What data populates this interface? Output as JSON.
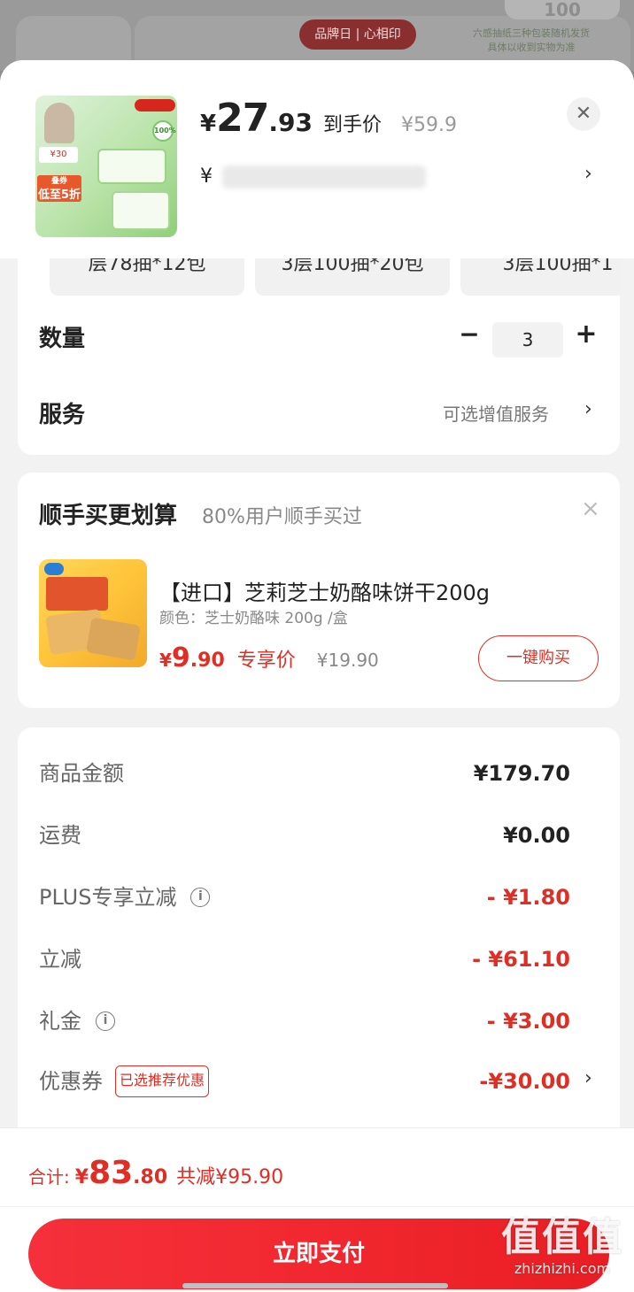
{
  "background": {
    "badge_text": "品牌日 | 心相印",
    "note_line1": "六感抽纸三种包装随机发货",
    "note_line2": "具体以收到实物为准",
    "corner_text": "100"
  },
  "product": {
    "currency": "¥",
    "price_integer": "27",
    "price_decimal": ".93",
    "price_label": "到手价",
    "original_price": "¥59.9",
    "spec_prefix": "¥",
    "image_tag_100": "100%",
    "image_price": "¥30",
    "image_promo_line1": "叠券",
    "image_promo_line2": "低至5折"
  },
  "specs": {
    "chips": [
      {
        "line": "层78抽*12包"
      },
      {
        "line": "3层100抽*20包"
      },
      {
        "line": "3层100抽*1"
      }
    ]
  },
  "quantity": {
    "label": "数量",
    "minus": "−",
    "value": "3",
    "plus": "+"
  },
  "service": {
    "label": "服务",
    "value": "可选增值服务",
    "chevron": "›"
  },
  "upsell": {
    "title": "顺手买更划算",
    "subtitle": "80%用户顺手买过",
    "close": "×",
    "item_name": "【进口】芝莉芝士奶酪味饼干200g",
    "item_attr": "颜色：芝士奶酪味 200g /盒",
    "price_currency": "¥",
    "price_integer": "9",
    "price_decimal": ".90",
    "price_label": "专享价",
    "original_price": "¥19.90",
    "buy_button": "一键购买"
  },
  "summary": {
    "rows": [
      {
        "label": "商品金额",
        "value": "¥179.70"
      },
      {
        "label": "运费",
        "value": "¥0.00"
      },
      {
        "label": "PLUS专享立减",
        "value": "- ¥1.80"
      },
      {
        "label": "立减",
        "value": "- ¥61.10"
      },
      {
        "label": "礼金",
        "value": "- ¥3.00"
      },
      {
        "label": "优惠券",
        "value": "-¥30.00"
      }
    ],
    "coupon_tag": "已选推荐优惠",
    "info_icon": "i"
  },
  "footer": {
    "total_label": "合计:",
    "total_currency": "¥",
    "total_integer": "83",
    "total_decimal": ".80",
    "discount_text": "共减¥95.90",
    "pay_button": "立即支付"
  },
  "watermark": {
    "big": "值值值",
    "small": "zhizhizhi.com"
  },
  "colors": {
    "accent_red": "#e02e24",
    "pay_button": "#f0262d",
    "sheet_bg": "#f2f2f2"
  },
  "icons": {
    "close": "close-icon",
    "chevron": "chevron-right-icon",
    "info": "info-icon"
  }
}
